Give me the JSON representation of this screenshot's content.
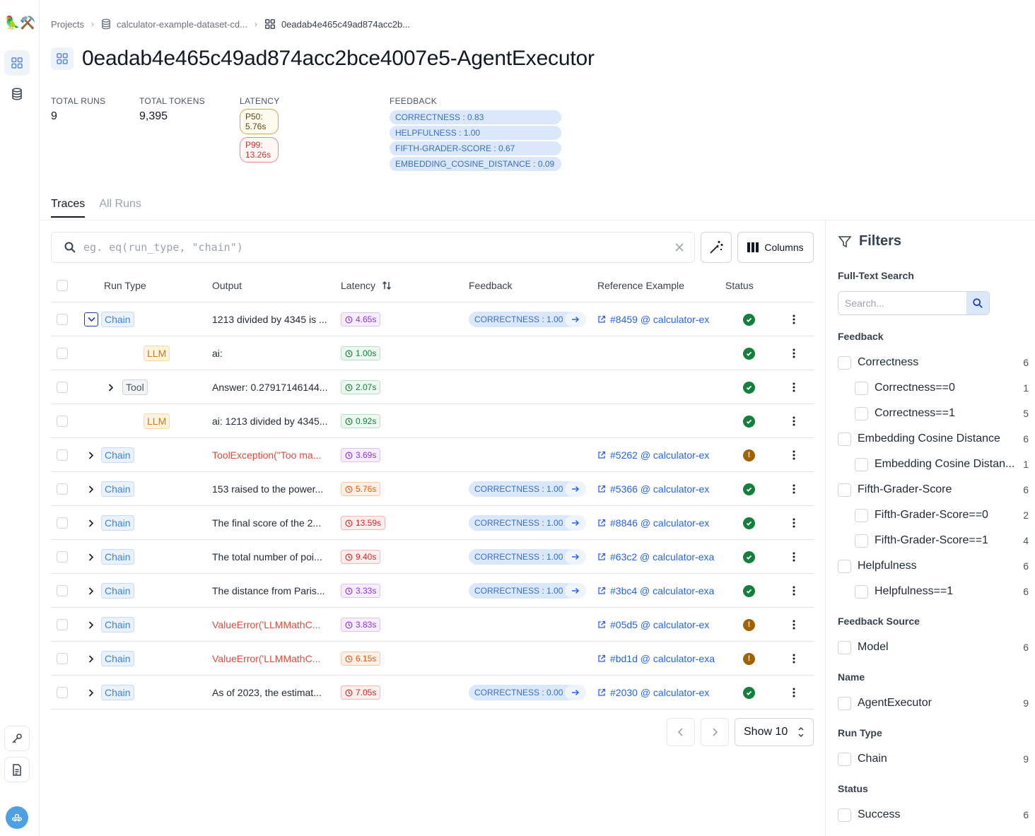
{
  "rail": {
    "logo": "🦜⚒️"
  },
  "breadcrumb": {
    "projects": "Projects",
    "dataset": "calculator-example-dataset-cd...",
    "project": "0eadab4e465c49ad874acc2b..."
  },
  "title": "0eadab4e465c49ad874acc2bce4007e5-AgentExecutor",
  "stats": {
    "total_runs_label": "TOTAL RUNS",
    "total_runs": "9",
    "total_tokens_label": "TOTAL TOKENS",
    "total_tokens": "9,395",
    "latency_label": "LATENCY",
    "p50": "P50: 5.76s",
    "p99": "P99: 13.26s",
    "feedback_label": "FEEDBACK",
    "feedback": [
      "CORRECTNESS : 0.83",
      "HELPFULNESS : 1.00",
      "FIFTH-GRADER-SCORE : 0.67",
      "EMBEDDING_COSINE_DISTANCE : 0.09"
    ]
  },
  "tabs": [
    "Traces",
    "All Runs"
  ],
  "search": {
    "placeholder": "eg. eq(run_type, \"chain\")"
  },
  "toolbar": {
    "columns_label": "Columns"
  },
  "table": {
    "headers": {
      "run_type": "Run Type",
      "output": "Output",
      "latency": "Latency",
      "feedback": "Feedback",
      "reference": "Reference Example",
      "status": "Status"
    },
    "rows": [
      {
        "indent": 0,
        "expander": "open",
        "type": "Chain",
        "type_style": "chain",
        "output": "1213 divided by 4345 is ...",
        "error": false,
        "latency": "4.65s",
        "lat_style": "purple",
        "feedback": "CORRECTNESS : 1.00",
        "reference": "#8459 @ calculator-ex",
        "status": "success"
      },
      {
        "indent": 2,
        "expander": "none",
        "type": "LLM",
        "type_style": "llm",
        "output": "ai:",
        "error": false,
        "latency": "1.00s",
        "lat_style": "green",
        "feedback": "",
        "reference": "",
        "status": "success"
      },
      {
        "indent": 1,
        "expander": "closed",
        "type": "Tool",
        "type_style": "tool",
        "output": "Answer: 0.27917146144...",
        "error": false,
        "latency": "2.07s",
        "lat_style": "green",
        "feedback": "",
        "reference": "",
        "status": "success"
      },
      {
        "indent": 2,
        "expander": "none",
        "type": "LLM",
        "type_style": "llm",
        "output": "ai: 1213 divided by 4345...",
        "error": false,
        "latency": "0.92s",
        "lat_style": "green",
        "feedback": "",
        "reference": "",
        "status": "success"
      },
      {
        "indent": 0,
        "expander": "closed",
        "type": "Chain",
        "type_style": "chain",
        "output": "ToolException(\"Too ma...",
        "error": true,
        "latency": "3.69s",
        "lat_style": "purple",
        "feedback": "",
        "reference": "#5262 @ calculator-ex",
        "status": "error"
      },
      {
        "indent": 0,
        "expander": "closed",
        "type": "Chain",
        "type_style": "chain",
        "output": "153 raised to the power...",
        "error": false,
        "latency": "5.76s",
        "lat_style": "orange",
        "feedback": "CORRECTNESS : 1.00",
        "reference": "#5366 @ calculator-ex",
        "status": "success"
      },
      {
        "indent": 0,
        "expander": "closed",
        "type": "Chain",
        "type_style": "chain",
        "output": "The final score of the 2...",
        "error": false,
        "latency": "13.59s",
        "lat_style": "red",
        "feedback": "CORRECTNESS : 1.00",
        "reference": "#8846 @ calculator-ex",
        "status": "success"
      },
      {
        "indent": 0,
        "expander": "closed",
        "type": "Chain",
        "type_style": "chain",
        "output": "The total number of poi...",
        "error": false,
        "latency": "9.40s",
        "lat_style": "red",
        "feedback": "CORRECTNESS : 1.00",
        "reference": "#63c2 @ calculator-exa",
        "status": "success"
      },
      {
        "indent": 0,
        "expander": "closed",
        "type": "Chain",
        "type_style": "chain",
        "output": "The distance from Paris...",
        "error": false,
        "latency": "3.33s",
        "lat_style": "purple",
        "feedback": "CORRECTNESS : 1.00",
        "reference": "#3bc4 @ calculator-exa",
        "status": "success"
      },
      {
        "indent": 0,
        "expander": "closed",
        "type": "Chain",
        "type_style": "chain",
        "output": "ValueError('LLMMathC...",
        "error": true,
        "latency": "3.83s",
        "lat_style": "purple",
        "feedback": "",
        "reference": "#05d5 @ calculator-ex",
        "status": "error"
      },
      {
        "indent": 0,
        "expander": "closed",
        "type": "Chain",
        "type_style": "chain",
        "output": "ValueError('LLMMathC...",
        "error": true,
        "latency": "6.15s",
        "lat_style": "orange",
        "feedback": "",
        "reference": "#bd1d @ calculator-exa",
        "status": "error"
      },
      {
        "indent": 0,
        "expander": "closed",
        "type": "Chain",
        "type_style": "chain",
        "output": "As of 2023, the estimat...",
        "error": false,
        "latency": "7.05s",
        "lat_style": "red",
        "feedback": "CORRECTNESS : 0.00",
        "reference": "#2030 @ calculator-ex",
        "status": "success"
      }
    ]
  },
  "pagination": {
    "show_label": "Show 10"
  },
  "filters": {
    "title": "Filters",
    "full_text_label": "Full-Text Search",
    "search_placeholder": "Search...",
    "sections": [
      {
        "title": "Feedback",
        "items": [
          {
            "label": "Correctness",
            "count": "6",
            "sub": false
          },
          {
            "label": "Correctness==0",
            "count": "1",
            "sub": true
          },
          {
            "label": "Correctness==1",
            "count": "5",
            "sub": true
          },
          {
            "label": "Embedding Cosine Distance",
            "count": "6",
            "sub": false
          },
          {
            "label": "Embedding Cosine Distan...",
            "count": "1",
            "sub": true
          },
          {
            "label": "Fifth-Grader-Score",
            "count": "6",
            "sub": false
          },
          {
            "label": "Fifth-Grader-Score==0",
            "count": "2",
            "sub": true
          },
          {
            "label": "Fifth-Grader-Score==1",
            "count": "4",
            "sub": true
          },
          {
            "label": "Helpfulness",
            "count": "6",
            "sub": false
          },
          {
            "label": "Helpfulness==1",
            "count": "6",
            "sub": true
          }
        ]
      },
      {
        "title": "Feedback Source",
        "items": [
          {
            "label": "Model",
            "count": "6",
            "sub": false
          }
        ]
      },
      {
        "title": "Name",
        "items": [
          {
            "label": "AgentExecutor",
            "count": "9",
            "sub": false
          }
        ]
      },
      {
        "title": "Run Type",
        "items": [
          {
            "label": "Chain",
            "count": "9",
            "sub": false
          }
        ]
      },
      {
        "title": "Status",
        "items": [
          {
            "label": "Success",
            "count": "6",
            "sub": false
          }
        ]
      }
    ]
  }
}
